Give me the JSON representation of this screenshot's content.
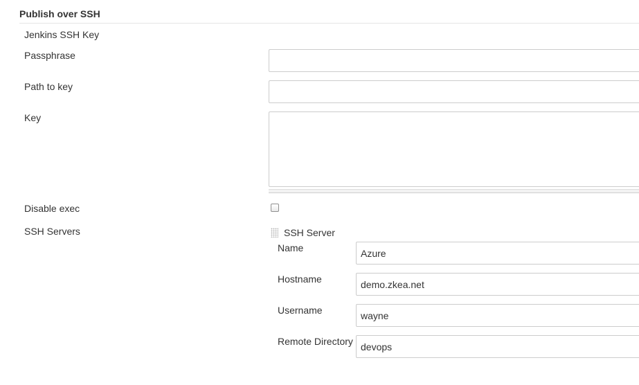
{
  "section": {
    "title": "Publish over SSH"
  },
  "jenkins_key": {
    "label": "Jenkins SSH Key",
    "passphrase_label": "Passphrase",
    "passphrase_value": "",
    "path_label": "Path to key",
    "path_value": "",
    "key_label": "Key",
    "key_value": ""
  },
  "disable_exec": {
    "label": "Disable exec",
    "checked": false
  },
  "ssh_servers": {
    "label": "SSH Servers",
    "server": {
      "title": "SSH Server",
      "name_label": "Name",
      "name_value": "Azure",
      "hostname_label": "Hostname",
      "hostname_value": "demo.zkea.net",
      "username_label": "Username",
      "username_value": "wayne",
      "remote_dir_label": "Remote Directory",
      "remote_dir_value": "devops"
    }
  }
}
